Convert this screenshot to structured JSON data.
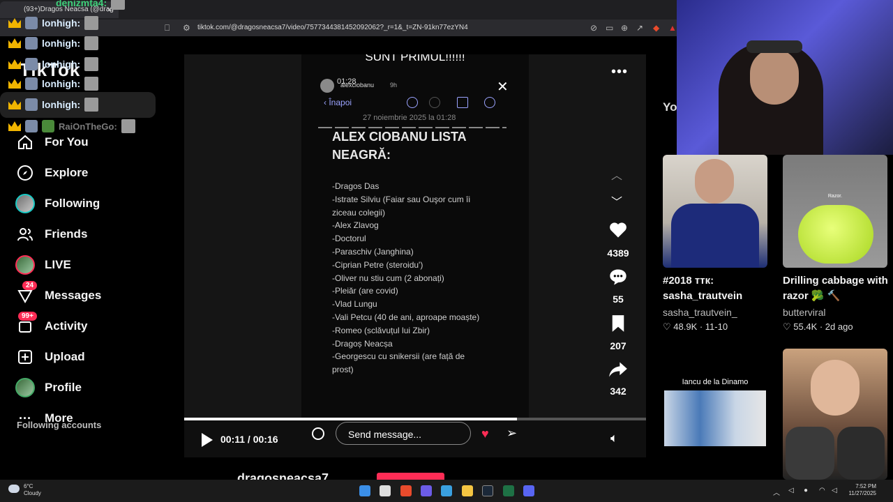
{
  "browser": {
    "tab_title": "(93+)Dragos Neacsa (@drag",
    "tab_close": "×",
    "url": "tiktok.com/@dragosneacsa7/video/7577344381452092062?_r=1&_t=ZN-91kn77ezYN4"
  },
  "chat": {
    "top_user": "denizmta4:",
    "lines": [
      "lonhigh:",
      "lonhigh:",
      "lonhigh:",
      "lonhigh:",
      "lonhigh:"
    ],
    "last_user": "RaiOnTheGo:"
  },
  "tiktok": {
    "logo": "TikTok",
    "nav": [
      {
        "label": "For You",
        "icon": "home-icon"
      },
      {
        "label": "Explore",
        "icon": "compass-icon"
      },
      {
        "label": "Following",
        "icon": "avatar"
      },
      {
        "label": "Friends",
        "icon": "friends-icon"
      },
      {
        "label": "LIVE",
        "icon": "live-avatar"
      },
      {
        "label": "Messages",
        "icon": "messages-icon",
        "badge": "24"
      },
      {
        "label": "Activity",
        "icon": "activity-icon",
        "badge": "99+"
      },
      {
        "label": "Upload",
        "icon": "upload-icon"
      },
      {
        "label": "Profile",
        "icon": "profile-avatar"
      },
      {
        "label": "More",
        "icon": "more-icon"
      }
    ],
    "following_accounts": "Following accounts"
  },
  "video": {
    "headline": "SUNT PRIMUL!!!!!!",
    "status_time": "01:28",
    "story_user": "alexciobanu",
    "story_age": "9h",
    "back_label": "Înapoi",
    "date_line": "27 noiembrie 2025 la 01:28",
    "list_title": "ALEX CIOBANU LISTA NEAGRĂ:",
    "list_items": [
      "-Dragos Das",
      "-Istrate Silviu (Faiar sau Ouşor cum îi",
      "ziceau colegii)",
      "-Alex Zlavog",
      "-Doctorul",
      "-Paraschiv (Janghina)",
      "-Ciprian Petre (steroidu')",
      "-Oliver nu stiu cum (2 abonați)",
      "-Pleiăr (are covid)",
      "-Vlad Lungu",
      "-Vali Petcu (40 de ani, aproape moaște)",
      "-Romeo (sclăvuțul lui Zbir)",
      "-Dragoș Neacșa",
      "-Georgescu cu snikersii (are față de",
      "prost)"
    ],
    "likes": "4389",
    "comments": "55",
    "saves": "207",
    "shares": "342",
    "progress": 0.72,
    "time": "00:11 / 00:16",
    "message_placeholder": "Send message...",
    "author": "dragosneacsa7"
  },
  "recommendations": {
    "title": "Yo",
    "items": [
      {
        "title": "#2018 ттк: sasha_trautvein",
        "author": "sasha_trautvein_",
        "stats": "♡ 48.9K · 11-10"
      },
      {
        "title": "Drilling cabbage with razor 🥦 🔨",
        "author": "butterviral",
        "stats": "♡ 55.4K · 2d ago",
        "thumb_label": "Razor."
      },
      {
        "caption": "Iancu de la Dinamo"
      }
    ]
  },
  "taskbar": {
    "weather_temp": "6°C",
    "weather_desc": "Cloudy",
    "time": "7:52 PM",
    "date": "11/27/2025"
  },
  "colors": {
    "accent": "#fe2c55",
    "teal": "#18c9c4",
    "page": "#000000"
  }
}
